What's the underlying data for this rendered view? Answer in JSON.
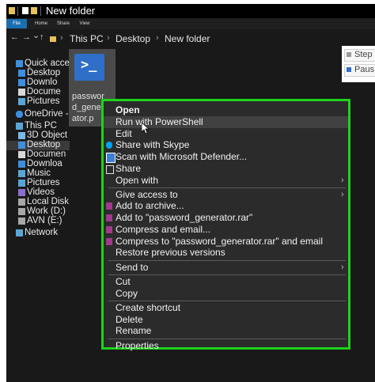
{
  "window": {
    "title": "New folder"
  },
  "ribbon": {
    "tabs": [
      "File",
      "Home",
      "Share",
      "View"
    ]
  },
  "address": {
    "back": "←",
    "forward": "→",
    "dropdown": "⌄",
    "up": "↑",
    "separator": "›",
    "crumbs": [
      "This PC",
      "Desktop",
      "New folder"
    ]
  },
  "nav_pane": {
    "items": [
      {
        "label": "Quick acce",
        "icon": "star-icon"
      },
      {
        "label": "Desktop",
        "icon": "desktop-icon"
      },
      {
        "label": "Downlo",
        "icon": "download-icon"
      },
      {
        "label": "Docume",
        "icon": "document-icon"
      },
      {
        "label": "Pictures",
        "icon": "pictures-icon"
      },
      {
        "label": "OneDrive -",
        "icon": "cloud-icon"
      },
      {
        "label": "This PC",
        "icon": "computer-icon"
      },
      {
        "label": "3D Object",
        "icon": "cube-icon"
      },
      {
        "label": "Desktop",
        "icon": "desktop-icon"
      },
      {
        "label": "Documen",
        "icon": "document-icon"
      },
      {
        "label": "Downloa",
        "icon": "download-icon"
      },
      {
        "label": "Music",
        "icon": "music-icon"
      },
      {
        "label": "Pictures",
        "icon": "pictures-icon"
      },
      {
        "label": "Videos",
        "icon": "video-icon"
      },
      {
        "label": "Local Disk",
        "icon": "disk-icon"
      },
      {
        "label": "Work (D:)",
        "icon": "disk-icon"
      },
      {
        "label": "AVN (E:)",
        "icon": "disk-icon"
      },
      {
        "label": "Network",
        "icon": "network-icon"
      }
    ]
  },
  "file": {
    "name_lines": [
      "passwor",
      "d_gener",
      "ator.p"
    ],
    "icon_glyph": ">_"
  },
  "right_panel": {
    "items": [
      "Step",
      "Paus"
    ]
  },
  "context_menu": {
    "groups": [
      [
        {
          "label": "Open",
          "bold": true
        },
        {
          "label": "Run with PowerShell",
          "highlighted": true
        },
        {
          "label": "Edit"
        },
        {
          "label": "Share with Skype",
          "icon": "skype-icon"
        },
        {
          "label": "Scan with Microsoft Defender...",
          "icon": "defender-shield-icon"
        },
        {
          "label": "Share",
          "icon": "share-icon"
        },
        {
          "label": "Open with",
          "submenu": true
        }
      ],
      [
        {
          "label": "Give access to",
          "submenu": true
        },
        {
          "label": "Add to archive...",
          "icon": "winrar-icon"
        },
        {
          "label": "Add to \"password_generator.rar\"",
          "icon": "winrar-icon"
        },
        {
          "label": "Compress and email...",
          "icon": "winrar-icon"
        },
        {
          "label": "Compress to \"password_generator.rar\" and email",
          "icon": "winrar-icon"
        },
        {
          "label": "Restore previous versions"
        }
      ],
      [
        {
          "label": "Send to",
          "submenu": true
        }
      ],
      [
        {
          "label": "Cut"
        },
        {
          "label": "Copy"
        }
      ],
      [
        {
          "label": "Create shortcut"
        },
        {
          "label": "Delete"
        },
        {
          "label": "Rename"
        }
      ],
      [
        {
          "label": "Properties"
        }
      ]
    ],
    "submenu_arrow": "›"
  },
  "colors": {
    "accent_green": "#1fd11a",
    "powershell_blue": "#2f6fc7",
    "folder_yellow": "#e8c15a",
    "file_tab_blue": "#1a6fb0"
  }
}
